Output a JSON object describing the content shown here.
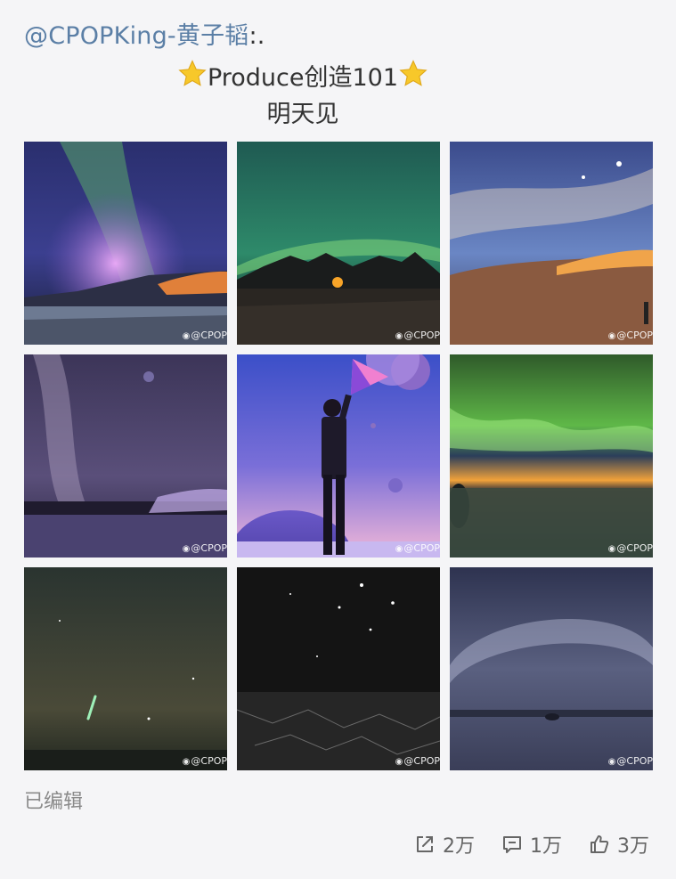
{
  "post": {
    "author": "@CPOPKing-黄子韬",
    "author_suffix": ":.",
    "line2": "Produce创造101",
    "line3": "明天见",
    "edited_label": "已编辑"
  },
  "photos": [
    {
      "watermark": "@CPOP"
    },
    {
      "watermark": "@CPOP"
    },
    {
      "watermark": "@CPOP"
    },
    {
      "watermark": "@CPOP"
    },
    {
      "watermark": "@CPOP"
    },
    {
      "watermark": "@CPOP"
    },
    {
      "watermark": "@CPOP"
    },
    {
      "watermark": "@CPOP"
    },
    {
      "watermark": "@CPOP"
    }
  ],
  "actions": {
    "repost_count": "2万",
    "comment_count": "1万",
    "like_count": "3万"
  },
  "colors": {
    "link": "#5b7fa6",
    "star": "#f5c518"
  },
  "icons": [
    "star-icon",
    "repost-icon",
    "comment-icon",
    "like-icon",
    "weibo-icon"
  ]
}
